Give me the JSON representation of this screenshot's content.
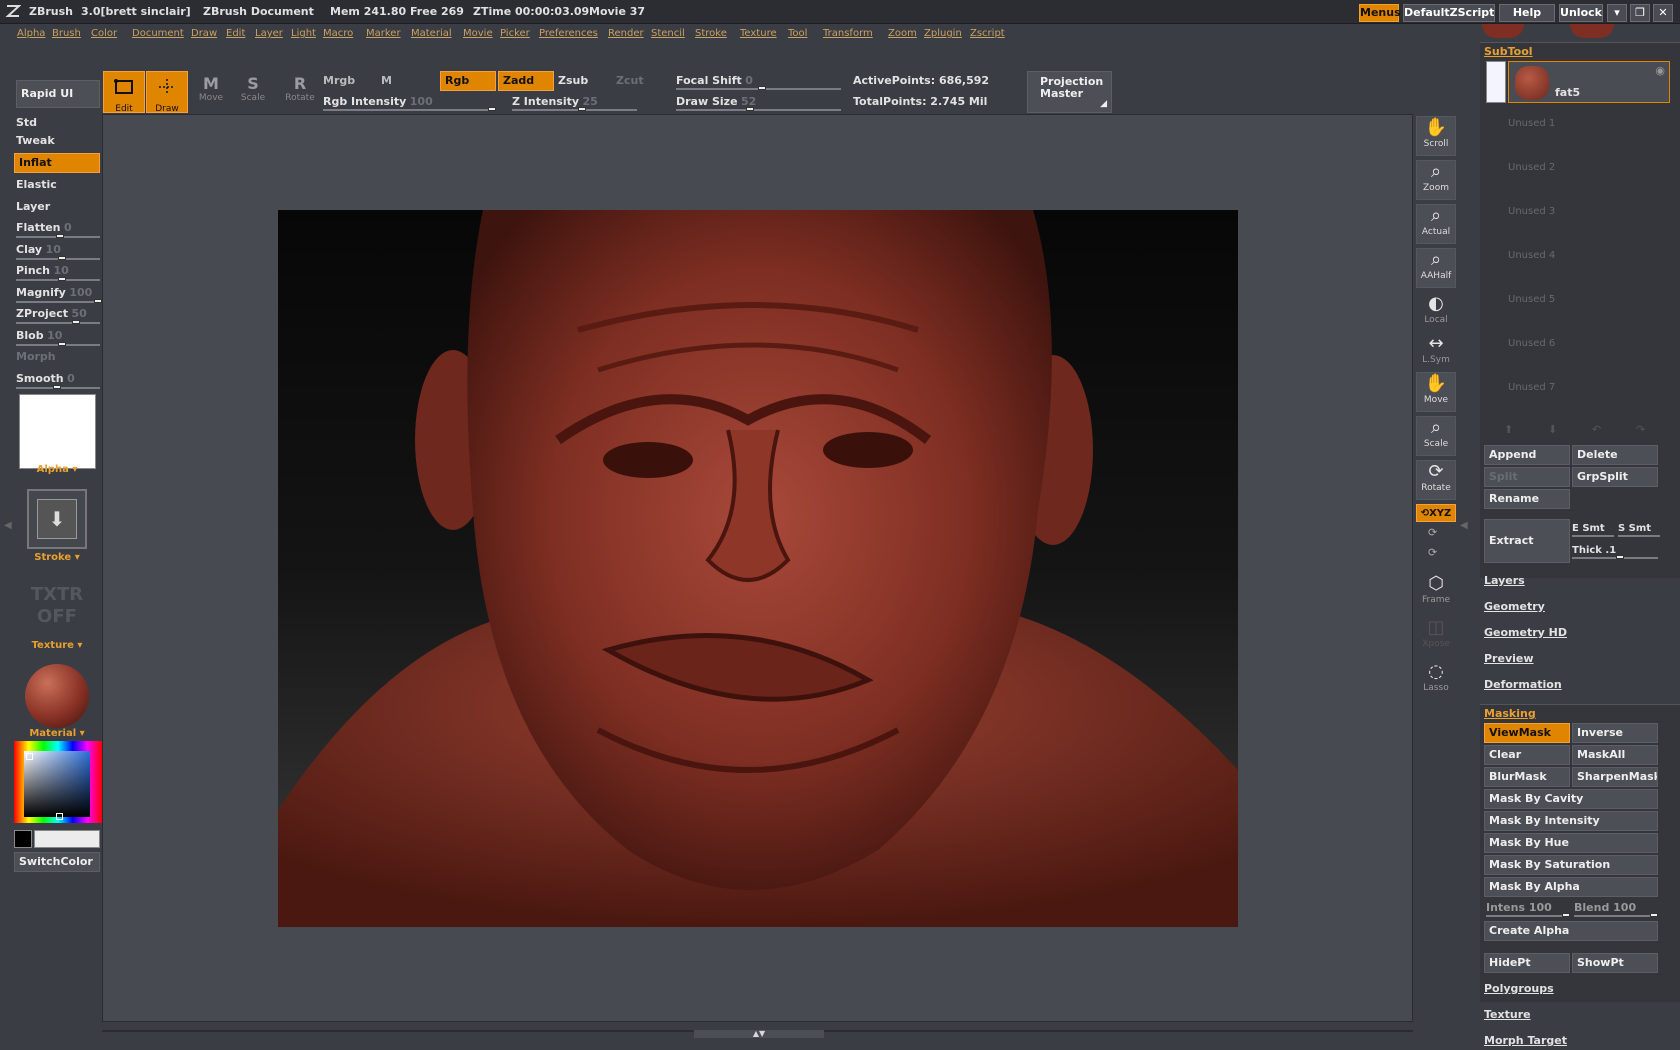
{
  "titlebar": {
    "app": "ZBrush",
    "version": "3.0[brett sinclair]",
    "document": "ZBrush Document",
    "mem": "Mem 241.80",
    "free": "Free 269",
    "ztime": "ZTime 00:00:03.09",
    "movie": "Movie 37",
    "menus_btn": "Menus",
    "script_btn": "DefaultZScript",
    "help_btn": "Help",
    "unlock_btn": "Unlock"
  },
  "menubar": [
    "Alpha",
    "Brush",
    "Color",
    "Document",
    "Draw",
    "Edit",
    "Layer",
    "Light",
    "Macro",
    "Marker",
    "Material",
    "Movie",
    "Picker",
    "Preferences",
    "Render",
    "Stencil",
    "Stroke",
    "Texture",
    "Tool",
    "Transform",
    "Zoom",
    "Zplugin",
    "Zscript"
  ],
  "toolbar": {
    "rapid_ui": "Rapid UI",
    "edit": "Edit",
    "draw": "Draw",
    "move": "Move",
    "scale": "Scale",
    "rotate": "Rotate",
    "mrgb": "Mrgb",
    "m": "M",
    "rgb": "Rgb",
    "zadd": "Zadd",
    "zsub": "Zsub",
    "zcut": "Zcut",
    "rgb_intensity_label": "Rgb Intensity",
    "rgb_intensity": "100",
    "z_intensity_label": "Z Intensity",
    "z_intensity": "25",
    "focal_shift_label": "Focal Shift",
    "focal_shift": "0",
    "draw_size_label": "Draw Size",
    "draw_size": "52",
    "active_points": "ActivePoints: 686,592",
    "total_points": "TotalPoints: 2.745 Mil",
    "projection_master_1": "Projection",
    "projection_master_2": "Master"
  },
  "left": {
    "brushes": [
      "Std",
      "Tweak",
      "Inflat",
      "Elastic",
      "Layer"
    ],
    "active_brush": "Inflat",
    "sliders": [
      {
        "label": "Flatten",
        "value": "0"
      },
      {
        "label": "Clay",
        "value": "10"
      },
      {
        "label": "Pinch",
        "value": "10"
      },
      {
        "label": "Magnify",
        "value": "100"
      },
      {
        "label": "ZProject",
        "value": "50"
      },
      {
        "label": "Blob",
        "value": "10"
      }
    ],
    "morph": "Morph",
    "smooth_label": "Smooth",
    "smooth_value": "0",
    "alpha_label": "Alpha",
    "stroke_label": "Stroke",
    "txtr1": "TXTR",
    "txtr2": "OFF",
    "texture_label": "Texture",
    "material_label": "Material",
    "switchcolor": "SwitchColor"
  },
  "right_tools": [
    {
      "label": "Scroll",
      "icon": "hand-icon"
    },
    {
      "label": "Zoom",
      "icon": "magnifier-icon"
    },
    {
      "label": "Actual",
      "icon": "magnifier-icon"
    },
    {
      "label": "AAHalf",
      "icon": "magnifier-icon"
    },
    {
      "label": "Local",
      "icon": "local-icon"
    },
    {
      "label": "L.Sym",
      "icon": "sym-icon"
    },
    {
      "label": "Move",
      "icon": "hand-icon"
    },
    {
      "label": "Scale",
      "icon": "magnifier-icon"
    },
    {
      "label": "Rotate",
      "icon": "rotate-icon"
    },
    {
      "label": "XYZ",
      "icon": "axis-icon"
    },
    {
      "label": "Frame",
      "icon": "cube-icon"
    },
    {
      "label": "Xpose",
      "icon": "xpose-icon"
    },
    {
      "label": "Lasso",
      "icon": "lasso-icon"
    }
  ],
  "subtool": {
    "header": "SubTool",
    "active_name": "fat5",
    "unused": [
      "Unused 1",
      "Unused 2",
      "Unused 3",
      "Unused 4",
      "Unused 5",
      "Unused 6",
      "Unused 7"
    ],
    "append": "Append",
    "delete": "Delete",
    "split": "Split",
    "grpsplit": "GrpSplit",
    "rename": "Rename",
    "extract": "Extract",
    "esmt": "E Smt",
    "ssmt": "S Smt",
    "thick": "Thick .1"
  },
  "right_links": [
    "Layers",
    "Geometry",
    "Geometry HD",
    "Preview",
    "Deformation"
  ],
  "masking": {
    "header": "Masking",
    "viewmask": "ViewMask",
    "inverse": "Inverse",
    "clear": "Clear",
    "maskall": "MaskAll",
    "blurmask": "BlurMask",
    "sharpenmask": "SharpenMask",
    "by_cavity": "Mask By Cavity",
    "by_intensity": "Mask By Intensity",
    "by_hue": "Mask By Hue",
    "by_saturation": "Mask By Saturation",
    "by_alpha": "Mask By Alpha",
    "intens": "Intens 100",
    "blend": "Blend 100",
    "create_alpha": "Create Alpha",
    "hidept": "HidePt",
    "showpt": "ShowPt"
  },
  "bottom_links": [
    "Polygroups",
    "Texture",
    "Morph Target"
  ],
  "colors": {
    "accent": "#e08500",
    "bg": "#3b3d44",
    "model": "#8a3226"
  }
}
